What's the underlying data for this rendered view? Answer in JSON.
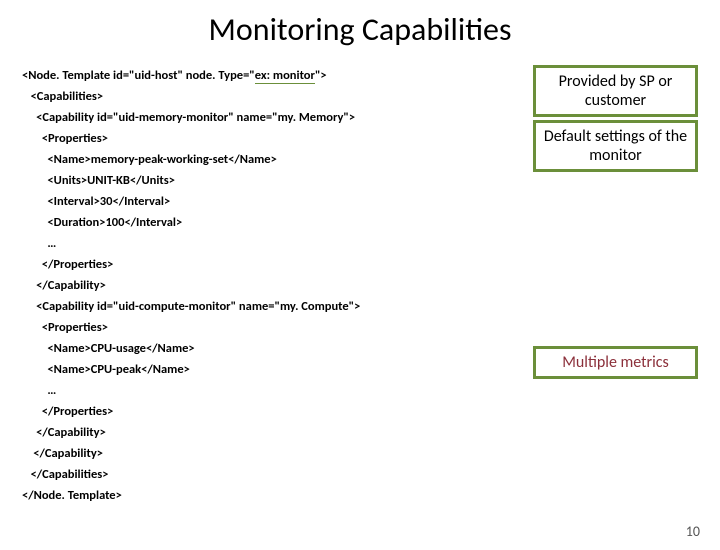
{
  "title": "Monitoring Capabilities",
  "code": {
    "l1a": "<Node. Template id=\"uid-host\" node. Type=\"",
    "l1b": "ex: monitor",
    "l1c": "\">",
    "l2": "   <Capabilities>",
    "l3": "     <Capability id=\"uid-memory-monitor\" name=\"my. Memory\">",
    "l4": "       <Properties>",
    "l5": "         <Name>memory-peak-working-set</Name>",
    "l6": "         <Units>UNIT-KB</Units>",
    "l7": "         <Interval>30</Interval>",
    "l8": "         <Duration>100</Interval>",
    "l9": "         …",
    "l10": "       </Properties>",
    "l11": "     </Capability>",
    "l12": "     <Capability id=\"uid-compute-monitor\" name=\"my. Compute\">",
    "l13": "       <Properties>",
    "l14": "         <Name>CPU-usage</Name>",
    "l15": "         <Name>CPU-peak</Name>",
    "l16": "         …",
    "l17": "       </Properties>",
    "l18": "     </Capability>",
    "l19": "    </Capability>",
    "l20": "   </Capabilities>",
    "l21": "</Node. Template>"
  },
  "callouts": {
    "c1": "Provided by SP or customer",
    "c2": "Default settings of the monitor",
    "c3": "Multiple metrics"
  },
  "page_number": "10"
}
